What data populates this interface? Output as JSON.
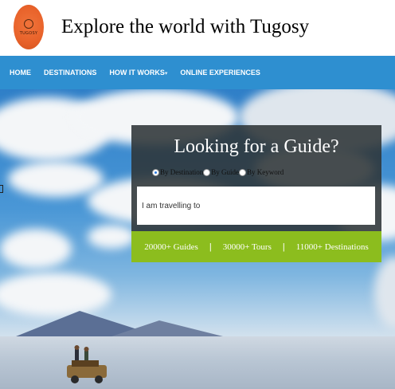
{
  "header": {
    "logo": {
      "text": "TUGOSY",
      "icon": "tugosy-logo-icon",
      "brand_color": "#e8622a"
    },
    "title": "Explore the world with Tugosy"
  },
  "nav": {
    "accent": "#2e8fd0",
    "items": [
      {
        "label": "HOME"
      },
      {
        "label": "DESTINATIONS"
      },
      {
        "label": "HOW IT WORKS",
        "has_dropdown": true,
        "icon": "chevron-down-icon"
      },
      {
        "label": "ONLINE EXPERIENCES"
      }
    ]
  },
  "guide_search": {
    "title": "Looking for a Guide?",
    "options": [
      {
        "label": "By Destination",
        "checked": true
      },
      {
        "label": "By Guide",
        "checked": false
      },
      {
        "label": "By Keyword",
        "checked": false
      }
    ],
    "input_placeholder": "I am travelling to",
    "stats": [
      "20000+ Guides",
      "30000+ Tours",
      "11000+ Destinations"
    ],
    "stats_color": "#8cbd1e",
    "separator": "|"
  }
}
